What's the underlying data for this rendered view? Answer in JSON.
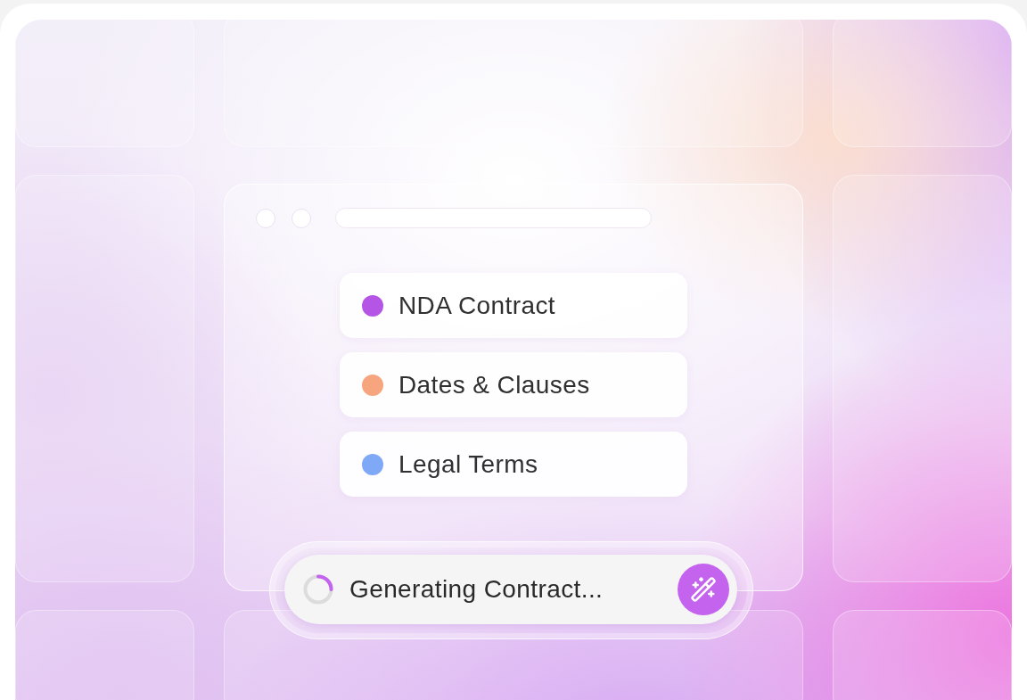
{
  "window": {
    "items": [
      {
        "label": "NDA Contract",
        "color": "#b455e6"
      },
      {
        "label": "Dates & Clauses",
        "color": "#f7a57f"
      },
      {
        "label": "Legal Terms",
        "color": "#7fa8f7"
      }
    ]
  },
  "status_bar": {
    "text": "Generating Contract..."
  }
}
